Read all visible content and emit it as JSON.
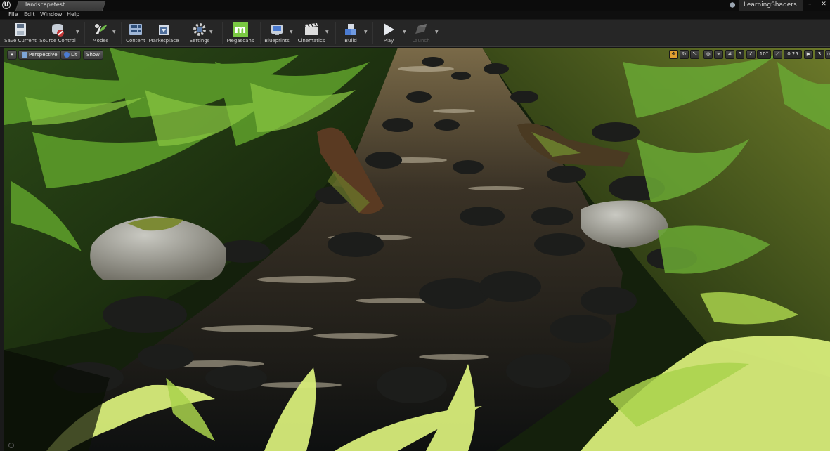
{
  "titlebar": {
    "level_tab": "landscapetest",
    "project_name": "LearningShaders",
    "minimize": "–",
    "close": "✕"
  },
  "menu": {
    "items": [
      "File",
      "Edit",
      "Window",
      "Help"
    ]
  },
  "toolbar": {
    "buttons": [
      {
        "label": "Save Current",
        "icon": "save-icon"
      },
      {
        "label": "Source Control",
        "icon": "source-control-icon"
      },
      {
        "label": "Modes",
        "icon": "modes-icon"
      },
      {
        "label": "Content",
        "icon": "content-icon"
      },
      {
        "label": "Marketplace",
        "icon": "marketplace-icon"
      },
      {
        "label": "Settings",
        "icon": "settings-icon"
      },
      {
        "label": "Megascans",
        "icon": "megascans-icon"
      },
      {
        "label": "Blueprints",
        "icon": "blueprints-icon"
      },
      {
        "label": "Cinematics",
        "icon": "cinematics-icon"
      },
      {
        "label": "Build",
        "icon": "build-icon"
      },
      {
        "label": "Play",
        "icon": "play-icon"
      },
      {
        "label": "Launch",
        "icon": "launch-icon"
      }
    ]
  },
  "viewport": {
    "options_menu": "▾",
    "perspective": "Perspective",
    "lit": "Lit",
    "show": "Show",
    "grid_snap_value": "5",
    "rotation_snap_value": "10°",
    "scale_snap_value": "0.25",
    "camera_speed": "3"
  },
  "colors": {
    "toolbar_bg": "#262626",
    "megascans_green": "#7ac943",
    "blueprint_blue": "#4b7bd1",
    "snap_active_orange": "#e0a030"
  }
}
